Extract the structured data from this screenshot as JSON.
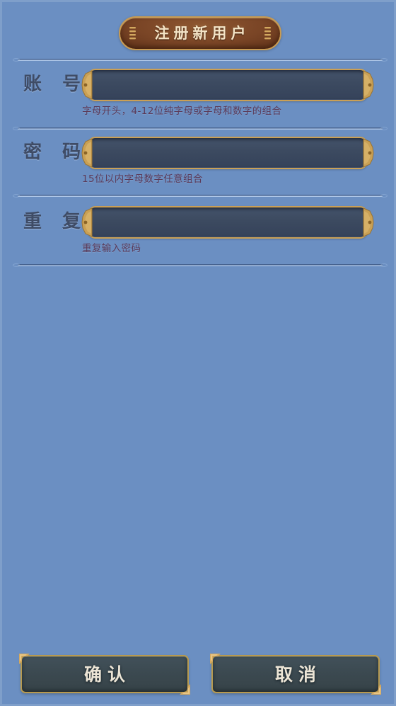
{
  "window": {
    "title": "注册新用户",
    "background_color": "#6b8fc2"
  },
  "header": {
    "title": "注册新用户",
    "pill_color": "#7a4526",
    "border_color": "#c79b53",
    "text_color": "#f4e4c6"
  },
  "form": {
    "fields": [
      {
        "label": "账  号",
        "value": "",
        "placeholder": "",
        "hint": "字母开头，4-12位纯字母或字母和数字的组合",
        "type": "text"
      },
      {
        "label": "密  码",
        "value": "",
        "placeholder": "",
        "hint": "15位以内字母数字任意组合",
        "type": "password"
      },
      {
        "label": "重  复",
        "value": "",
        "placeholder": "",
        "hint": "重复输入密码",
        "type": "password"
      }
    ],
    "field_fill_color": "#3c4a60",
    "field_border_color": "#caa056",
    "hint_color": "#5b3a58",
    "label_color": "#3f4c66"
  },
  "footer": {
    "confirm_label": "确认",
    "cancel_label": "取消",
    "button_fill_color": "#3b4950",
    "button_border_color": "#b79a4f",
    "button_text_color": "#ece5d6"
  }
}
